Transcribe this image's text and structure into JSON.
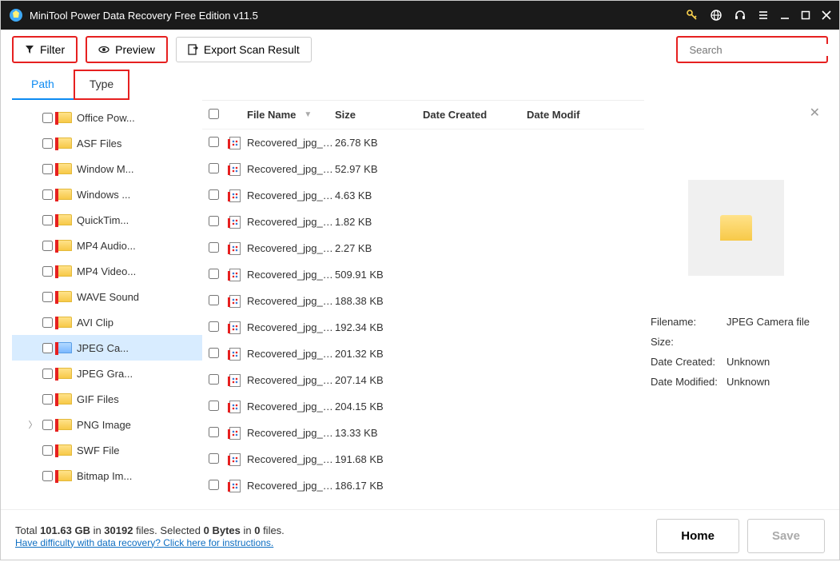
{
  "titlebar": {
    "title": "MiniTool Power Data Recovery Free Edition v11.5"
  },
  "toolbar": {
    "filter": "Filter",
    "preview": "Preview",
    "export": "Export Scan Result"
  },
  "search": {
    "placeholder": "Search"
  },
  "tabs": {
    "path": "Path",
    "type": "Type"
  },
  "sidebar": [
    {
      "label": "Office Pow..."
    },
    {
      "label": "ASF Files"
    },
    {
      "label": "Window M..."
    },
    {
      "label": "Windows ..."
    },
    {
      "label": "QuickTim..."
    },
    {
      "label": "MP4 Audio..."
    },
    {
      "label": "MP4 Video..."
    },
    {
      "label": "WAVE Sound"
    },
    {
      "label": "AVI Clip"
    },
    {
      "label": "JPEG Ca...",
      "selected": true,
      "blue": true
    },
    {
      "label": "JPEG Gra..."
    },
    {
      "label": "GIF Files"
    },
    {
      "label": "PNG Image",
      "expandable": true
    },
    {
      "label": "SWF File"
    },
    {
      "label": "Bitmap Im..."
    }
  ],
  "columns": {
    "name": "File Name",
    "size": "Size",
    "created": "Date Created",
    "modified": "Date Modif"
  },
  "files": [
    {
      "name": "Recovered_jpg_fil...",
      "size": "26.78 KB"
    },
    {
      "name": "Recovered_jpg_fil...",
      "size": "52.97 KB"
    },
    {
      "name": "Recovered_jpg_fil...",
      "size": "4.63 KB"
    },
    {
      "name": "Recovered_jpg_fil...",
      "size": "1.82 KB"
    },
    {
      "name": "Recovered_jpg_fil...",
      "size": "2.27 KB"
    },
    {
      "name": "Recovered_jpg_fil...",
      "size": "509.91 KB"
    },
    {
      "name": "Recovered_jpg_fil...",
      "size": "188.38 KB"
    },
    {
      "name": "Recovered_jpg_fil...",
      "size": "192.34 KB"
    },
    {
      "name": "Recovered_jpg_fil...",
      "size": "201.32 KB"
    },
    {
      "name": "Recovered_jpg_fil...",
      "size": "207.14 KB"
    },
    {
      "name": "Recovered_jpg_fil...",
      "size": "204.15 KB"
    },
    {
      "name": "Recovered_jpg_fil...",
      "size": "13.33 KB"
    },
    {
      "name": "Recovered_jpg_fil...",
      "size": "191.68 KB"
    },
    {
      "name": "Recovered_jpg_fil...",
      "size": "186.17 KB"
    }
  ],
  "detail": {
    "labels": {
      "filename": "Filename:",
      "size": "Size:",
      "created": "Date Created:",
      "modified": "Date Modified:"
    },
    "filename": "JPEG Camera file",
    "size": "",
    "created": "Unknown",
    "modified": "Unknown"
  },
  "footer": {
    "total_prefix": "Total ",
    "total_gb": "101.63 GB",
    "in": " in ",
    "total_files": "30192",
    "files_suffix": " files. ",
    "sel_prefix": " Selected ",
    "sel_bytes": "0 Bytes",
    "sel_in": " in ",
    "sel_files": "0",
    "sel_suffix": " files.",
    "help_link": "Have difficulty with data recovery? Click here for instructions.",
    "home": "Home",
    "save": "Save"
  }
}
